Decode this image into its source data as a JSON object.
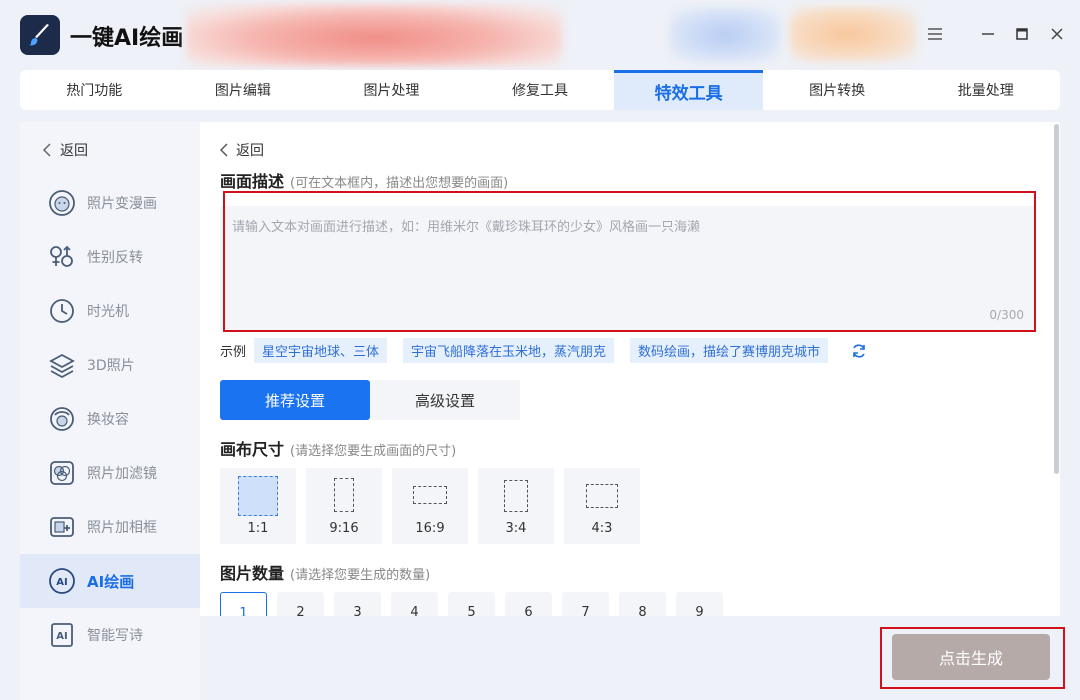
{
  "app": {
    "title": "一键AI绘画",
    "logo_icon": "brush-icon",
    "window_controls": [
      "menu-icon",
      "minimize-icon",
      "maximize-icon",
      "close-icon"
    ]
  },
  "tabs": [
    {
      "label": "热门功能",
      "active": false
    },
    {
      "label": "图片编辑",
      "active": false
    },
    {
      "label": "图片处理",
      "active": false
    },
    {
      "label": "修复工具",
      "active": false
    },
    {
      "label": "特效工具",
      "active": true
    },
    {
      "label": "图片转换",
      "active": false
    },
    {
      "label": "批量处理",
      "active": false
    }
  ],
  "sidebar": {
    "back_label": "返回",
    "items": [
      {
        "label": "照片变漫画",
        "icon": "cartoon-face-icon",
        "active": false
      },
      {
        "label": "性别反转",
        "icon": "gender-icon",
        "active": false
      },
      {
        "label": "时光机",
        "icon": "time-machine-icon",
        "active": false
      },
      {
        "label": "3D照片",
        "icon": "layers-icon",
        "active": false
      },
      {
        "label": "换妆容",
        "icon": "makeup-face-icon",
        "active": false
      },
      {
        "label": "照片加滤镜",
        "icon": "filter-icon",
        "active": false
      },
      {
        "label": "照片加相框",
        "icon": "frame-icon",
        "active": false
      },
      {
        "label": "AI绘画",
        "icon": "ai-painting-icon",
        "active": true
      },
      {
        "label": "智能写诗",
        "icon": "ai-poem-icon",
        "active": false
      }
    ]
  },
  "main": {
    "back_label": "返回",
    "description": {
      "title": "画面描述",
      "hint": "(可在文本框内，描述出您想要的画面)",
      "placeholder": "请输入文本对画面进行描述，如：用维米尔《戴珍珠耳环的少女》风格画一只海濑",
      "value": "",
      "counter": "0/300"
    },
    "examples": {
      "label": "示例",
      "chips": [
        "星空宇宙地球、三体",
        "宇宙飞船降落在玉米地，蒸汽朋克",
        "数码绘画，描绘了赛博朋克城市"
      ]
    },
    "settings_tabs": [
      {
        "label": "推荐设置",
        "active": true
      },
      {
        "label": "高级设置",
        "active": false
      }
    ],
    "canvas_size": {
      "title": "画布尺寸",
      "hint": "(请选择您要生成画面的尺寸)",
      "options": [
        {
          "label": "1:1",
          "active": true
        },
        {
          "label": "9:16",
          "active": false
        },
        {
          "label": "16:9",
          "active": false
        },
        {
          "label": "3:4",
          "active": false
        },
        {
          "label": "4:3",
          "active": false
        }
      ]
    },
    "image_count": {
      "title": "图片数量",
      "hint": "(请选择您要生成的数量)",
      "options": [
        "1",
        "2",
        "3",
        "4",
        "5",
        "6",
        "7",
        "8",
        "9"
      ],
      "selected": "1"
    }
  },
  "generate_button": "点击生成",
  "colors": {
    "accent": "#1a6ee8",
    "highlight_box": "#d0101b",
    "generate_disabled": "#b5aaa8"
  }
}
